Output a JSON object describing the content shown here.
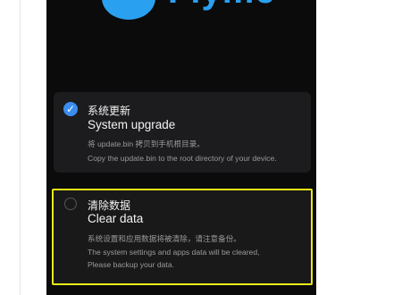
{
  "logo": {
    "text": "Flyme"
  },
  "options": [
    {
      "title_cn": "系统更新",
      "title_en": "System upgrade",
      "desc_cn": "将 update.bin 拷贝到手机根目录。",
      "desc_en": "Copy the update.bin to the root directory of your device.",
      "checked": true
    },
    {
      "title_cn": "清除数据",
      "title_en": "Clear data",
      "desc_cn": "系统设置和应用数据将被清除，请注意备份。",
      "desc_en_line1": "The system settings and apps data will be cleared,",
      "desc_en_line2": "Please backup your data.",
      "checked": false
    }
  ],
  "colors": {
    "accent": "#2aa0f0",
    "checkbox": "#3a8ef0",
    "highlight_border": "#e8ea19",
    "screen_bg": "#0b0b0b",
    "card_bg": "#1c1c1e"
  },
  "icons": {
    "checked": "check-circle-icon",
    "unchecked": "radio-empty-icon",
    "logo": "flyme-bubble-icon"
  }
}
